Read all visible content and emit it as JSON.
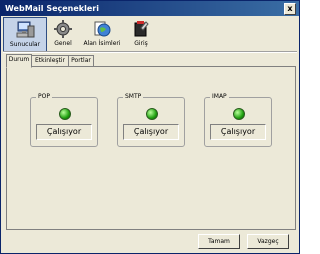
{
  "window": {
    "title": "WebMail Seçenekleri",
    "close_glyph": "x"
  },
  "toolbar": {
    "items": [
      {
        "label": "Sunucular",
        "icon": "computer-icon",
        "active": true
      },
      {
        "label": "Genel",
        "icon": "gear-icon",
        "active": false
      },
      {
        "label": "Alan İsimleri",
        "icon": "globe-icon",
        "active": false
      },
      {
        "label": "Giriş",
        "icon": "login-icon",
        "active": false
      }
    ]
  },
  "tabs": [
    {
      "label": "Durum",
      "active": true
    },
    {
      "label": "Etkinleştir",
      "active": false
    },
    {
      "label": "Portlar",
      "active": false
    }
  ],
  "services": [
    {
      "name": "POP",
      "status": "Çalışıyor",
      "led_color": "#20a010"
    },
    {
      "name": "SMTP",
      "status": "Çalışıyor",
      "led_color": "#20a010"
    },
    {
      "name": "IMAP",
      "status": "Çalışıyor",
      "led_color": "#20a010"
    }
  ],
  "buttons": {
    "ok_label": "Tamam",
    "cancel_label": "Vazgeç"
  }
}
